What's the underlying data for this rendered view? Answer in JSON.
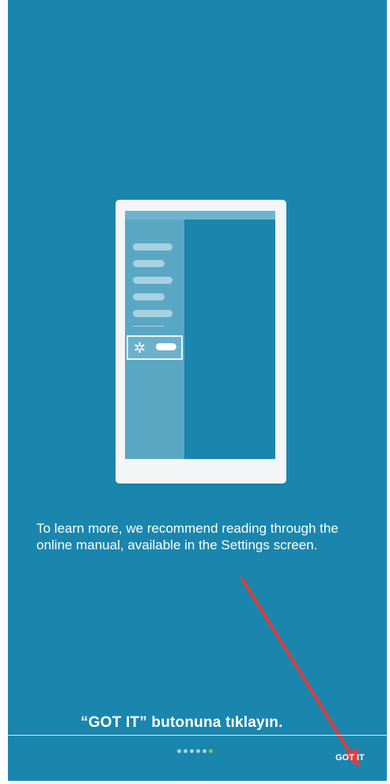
{
  "colors": {
    "background": "#1a86ad",
    "illustration_frame": "#f3f5f6",
    "drawer": "#5aa7c3",
    "active_dot": "#8cc63e",
    "annotation_arrow": "#e23b3b"
  },
  "illustration": {
    "menu_lines": 5,
    "selected_item_icon": "gear-icon"
  },
  "message": "To learn more, we recommend reading through the online manual, available in the Settings screen.",
  "annotation": "“GOT IT” butonuna tıklayın.",
  "pager": {
    "total_pages": 6,
    "current_page": 6
  },
  "actions": {
    "got_it_label": "GOT IT"
  }
}
